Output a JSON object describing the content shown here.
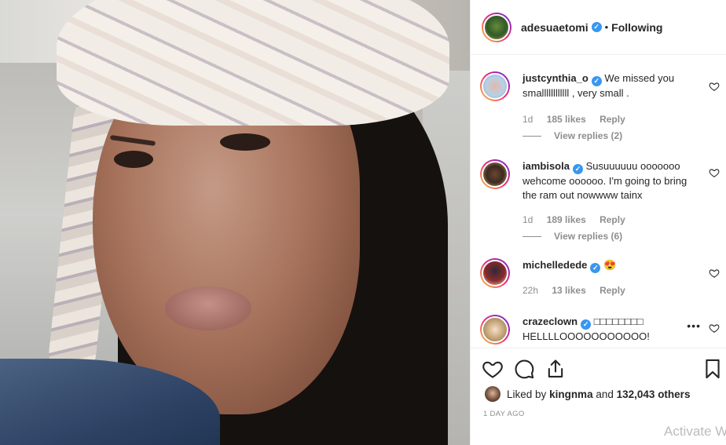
{
  "post": {
    "author": "adesuaetomi",
    "separator": "•",
    "follow_status": "Following"
  },
  "comments": [
    {
      "username": "justcynthia_o",
      "text": "We missed you smallllllllllll , very small .",
      "emoji": "",
      "age": "1d",
      "likes": "185 likes",
      "reply": "Reply",
      "view_replies": "View replies (2)"
    },
    {
      "username": "iambisola",
      "text": "Susuuuuuu ooooooo wehcome oooooo. I'm going to bring the ram out nowwww tainx",
      "emoji": "",
      "age": "1d",
      "likes": "189 likes",
      "reply": "Reply",
      "view_replies": "View replies (6)"
    },
    {
      "username": "michelledede",
      "text": "",
      "emoji": "😍",
      "age": "22h",
      "likes": "13 likes",
      "reply": "Reply",
      "view_replies": ""
    },
    {
      "username": "crazeclown",
      "text": "□□□□□□□□ HELLLLOOOOOOOOOOO!",
      "emoji": "",
      "age": "",
      "likes": "",
      "reply": "",
      "view_replies": ""
    }
  ],
  "more_options": "•••",
  "likes_summary": {
    "prefix": "Liked by",
    "user": "kingnma",
    "joiner": "and",
    "others": "132,043 others"
  },
  "time_ago": "1 DAY AGO",
  "os_watermark": "Activate W",
  "icons": {
    "like": "heart-icon",
    "comment": "comment-icon",
    "share": "share-icon",
    "save": "bookmark-icon",
    "verified": "verified-badge-icon"
  },
  "colors": {
    "verified": "#3897f0",
    "meta_text": "#8e8e8e",
    "primary_text": "#262626"
  }
}
